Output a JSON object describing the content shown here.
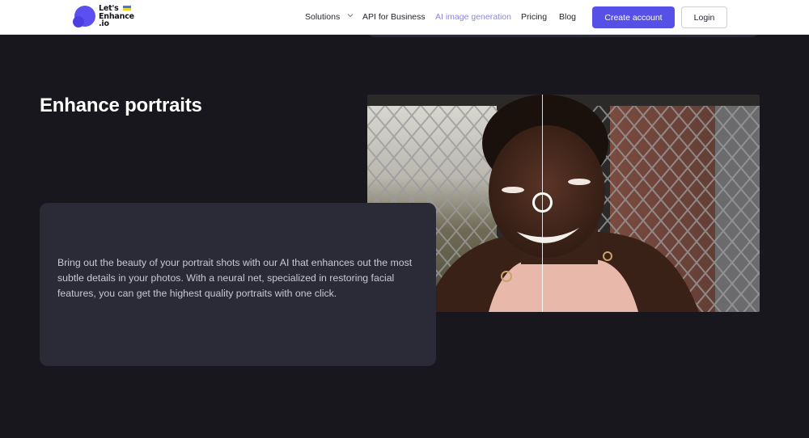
{
  "brand": {
    "logo_lines": [
      "Let's",
      "Enhance",
      ".io"
    ],
    "accent": "#5750e6"
  },
  "nav": {
    "items": [
      {
        "label": "Solutions",
        "has_dropdown": true
      },
      {
        "label": "API for Business"
      },
      {
        "label": "AI image generation",
        "active": true
      },
      {
        "label": "Pricing"
      },
      {
        "label": "Blog"
      }
    ],
    "create_account": "Create account",
    "login": "Login"
  },
  "section": {
    "title": "Enhance portraits",
    "description": "Bring out the beauty of your portrait shots with our AI that enhances out the most subtle details in your photos. With a neural net, specialized in restoring facial features, you can get the highest quality portraits with one click."
  },
  "comparison": {
    "slider_position": 0.45
  },
  "colors": {
    "background": "#17171d",
    "card": "#2b2b37",
    "nav_active": "#8b86e0"
  }
}
